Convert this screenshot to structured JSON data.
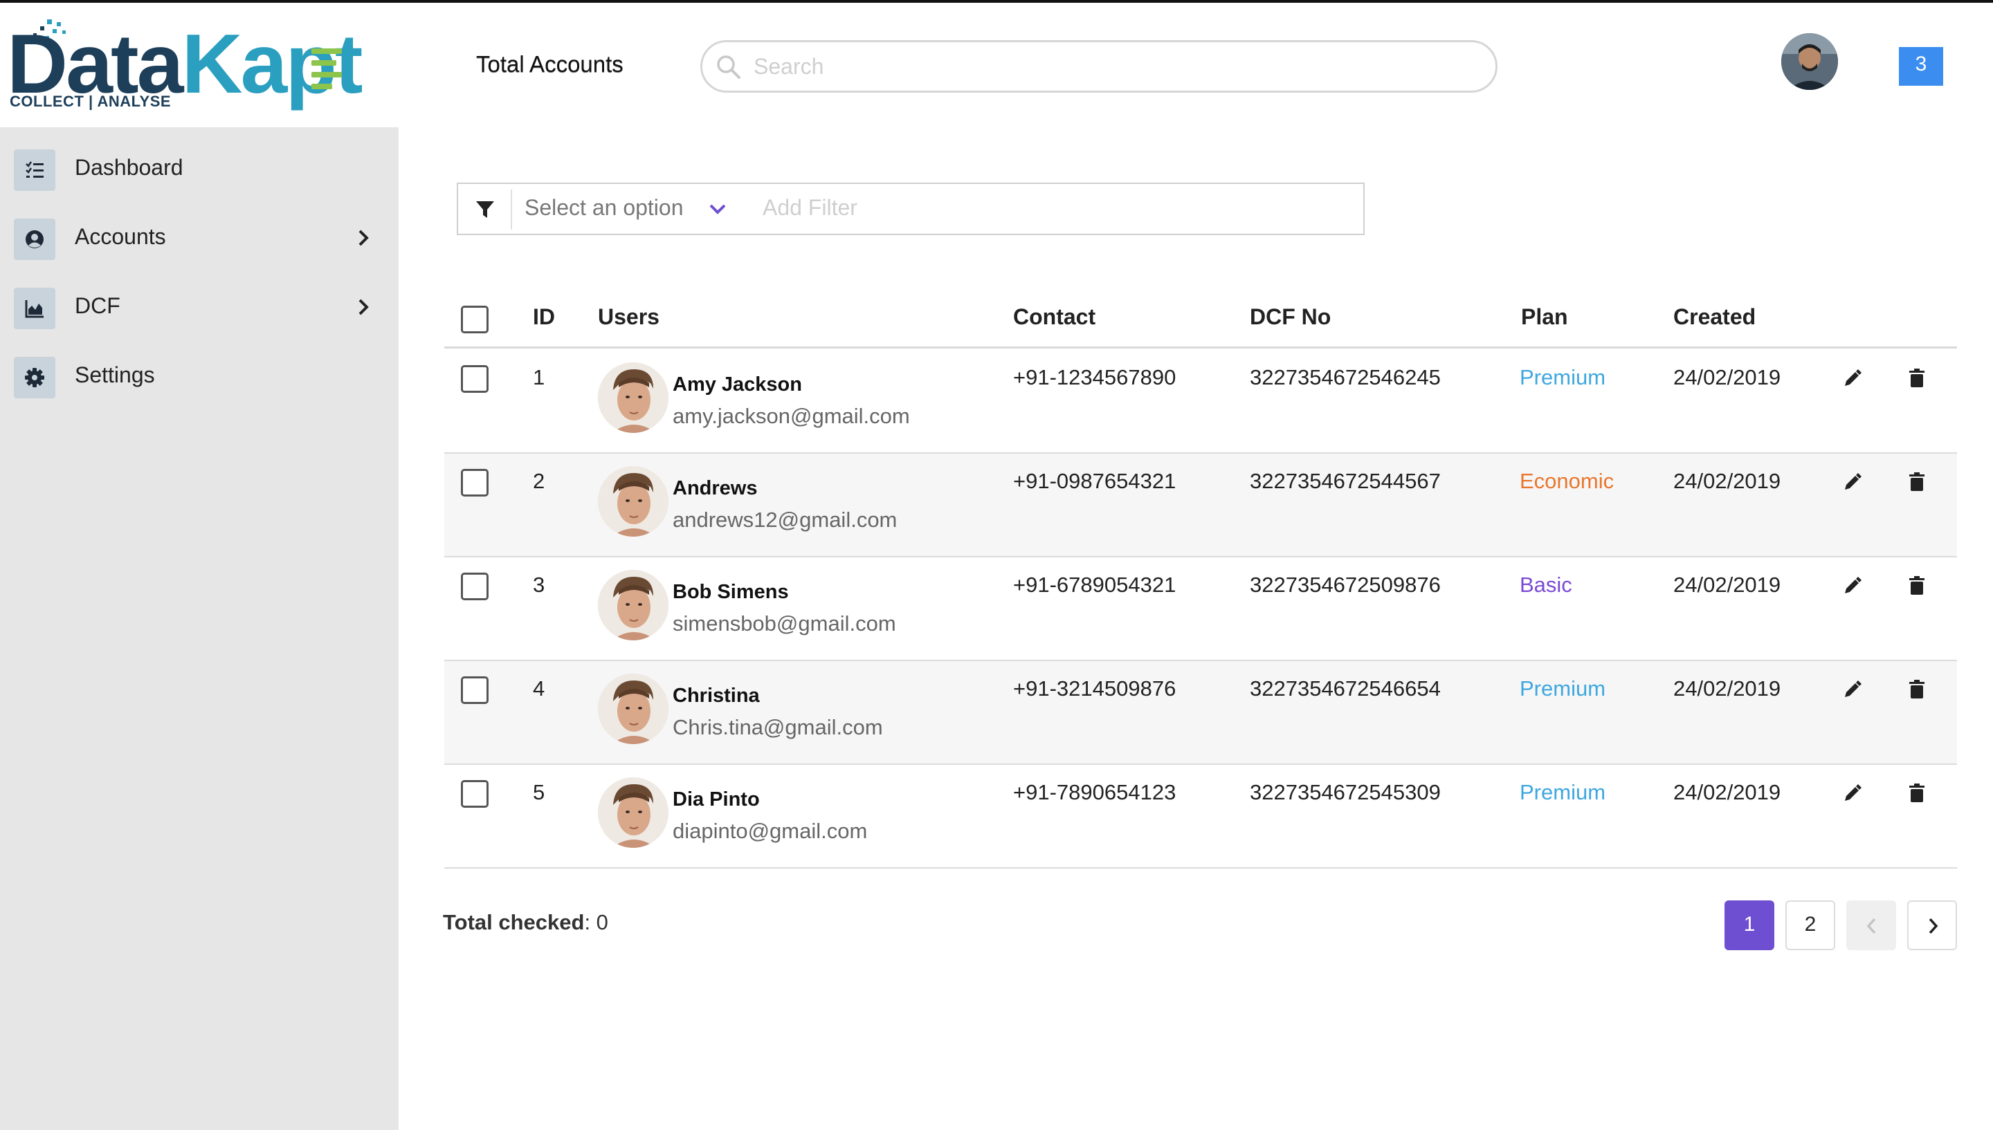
{
  "brand": {
    "name_part1": "Data",
    "name_part2": "Kapt",
    "tagline": "COLLECT | ANALYSE"
  },
  "header": {
    "title": "Total Accounts",
    "search_placeholder": "Search",
    "notification_count": "3"
  },
  "sidebar": {
    "items": [
      {
        "label": "Dashboard",
        "icon": "list-icon"
      },
      {
        "label": "Accounts",
        "icon": "user-circle-icon"
      },
      {
        "label": "DCF",
        "icon": "area-chart-icon"
      },
      {
        "label": "Settings",
        "icon": "gear-icon"
      }
    ]
  },
  "filter": {
    "select_placeholder": "Select an option",
    "add_placeholder": "Add Filter"
  },
  "table": {
    "columns": [
      "ID",
      "Users",
      "Contact",
      "DCF No",
      "Plan",
      "Created"
    ],
    "rows": [
      {
        "id": "1",
        "name": "Amy Jackson",
        "email": "amy.jackson@gmail.com",
        "contact": "+91-1234567890",
        "dcf": "3227354672546245",
        "plan": "Premium",
        "created": "24/02/2019"
      },
      {
        "id": "2",
        "name": "Andrews",
        "email": "andrews12@gmail.com",
        "contact": "+91-0987654321",
        "dcf": "3227354672544567",
        "plan": "Economic",
        "created": "24/02/2019"
      },
      {
        "id": "3",
        "name": "Bob Simens",
        "email": "simensbob@gmail.com",
        "contact": "+91-6789054321",
        "dcf": "3227354672509876",
        "plan": "Basic",
        "created": "24/02/2019"
      },
      {
        "id": "4",
        "name": "Christina",
        "email": "Chris.tina@gmail.com",
        "contact": "+91-3214509876",
        "dcf": "3227354672546654",
        "plan": "Premium",
        "created": "24/02/2019"
      },
      {
        "id": "5",
        "name": "Dia Pinto",
        "email": "diapinto@gmail.com",
        "contact": "+91-7890654123",
        "dcf": "3227354672545309",
        "plan": "Premium",
        "created": "24/02/2019"
      }
    ]
  },
  "plan_colors": {
    "Premium": "#3ea7e0",
    "Economic": "#e8772e",
    "Basic": "#7a4ad6"
  },
  "footer": {
    "total_label": "Total checked",
    "total_value": ": 0",
    "pages": [
      "1",
      "2"
    ],
    "active_page": "1"
  },
  "colors": {
    "accent": "#6f4fd1",
    "notification": "#3b8ef0",
    "sidebar_bg": "#e6e6e6"
  }
}
